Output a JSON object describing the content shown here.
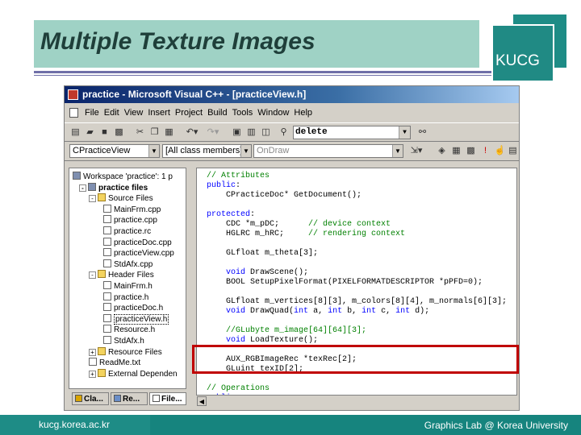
{
  "slide": {
    "title": "Multiple Texture Images",
    "logo": "KUCG",
    "footer_left": "kucg.korea.ac.kr",
    "footer_right": "Graphics Lab @ Korea University"
  },
  "window": {
    "title": "practice - Microsoft Visual C++ - [practiceView.h]",
    "menu": [
      "File",
      "Edit",
      "View",
      "Insert",
      "Project",
      "Build",
      "Tools",
      "Window",
      "Help"
    ],
    "find_value": "delete",
    "class_combo": "CPracticeView",
    "members_combo": "[All class members]",
    "function_combo": "OnDraw"
  },
  "workspace": {
    "rows": [
      {
        "label": "Workspace 'practice': 1 p",
        "depth": 0,
        "icon": "workspace-icon",
        "exp": ""
      },
      {
        "label": "practice files",
        "depth": 1,
        "icon": "project-icon",
        "exp": "-",
        "bold": true
      },
      {
        "label": "Source Files",
        "depth": 2,
        "icon": "folder-icon",
        "exp": "-"
      },
      {
        "label": "MainFrm.cpp",
        "depth": 3,
        "icon": "file-icon",
        "exp": ""
      },
      {
        "label": "practice.cpp",
        "depth": 3,
        "icon": "file-icon",
        "exp": ""
      },
      {
        "label": "practice.rc",
        "depth": 3,
        "icon": "file-icon",
        "exp": ""
      },
      {
        "label": "practiceDoc.cpp",
        "depth": 3,
        "icon": "file-icon",
        "exp": ""
      },
      {
        "label": "practiceView.cpp",
        "depth": 3,
        "icon": "file-icon",
        "exp": ""
      },
      {
        "label": "StdAfx.cpp",
        "depth": 3,
        "icon": "file-icon",
        "exp": ""
      },
      {
        "label": "Header Files",
        "depth": 2,
        "icon": "folder-icon",
        "exp": "-"
      },
      {
        "label": "MainFrm.h",
        "depth": 3,
        "icon": "file-icon",
        "exp": ""
      },
      {
        "label": "practice.h",
        "depth": 3,
        "icon": "file-icon",
        "exp": ""
      },
      {
        "label": "practiceDoc.h",
        "depth": 3,
        "icon": "file-icon",
        "exp": ""
      },
      {
        "label": "practiceView.h",
        "depth": 3,
        "icon": "file-icon",
        "exp": "",
        "selected": true
      },
      {
        "label": "Resource.h",
        "depth": 3,
        "icon": "file-icon",
        "exp": ""
      },
      {
        "label": "StdAfx.h",
        "depth": 3,
        "icon": "file-icon",
        "exp": ""
      },
      {
        "label": "Resource Files",
        "depth": 2,
        "icon": "folder-icon",
        "exp": "+"
      },
      {
        "label": "ReadMe.txt",
        "depth": 2,
        "icon": "file-icon",
        "exp": ""
      },
      {
        "label": "External Dependen",
        "depth": 2,
        "icon": "folder-icon",
        "exp": "+"
      }
    ],
    "tabs": [
      "Cla...",
      "Re...",
      "File..."
    ]
  },
  "code": [
    {
      "parts": [
        {
          "c": "cm",
          "t": "// Attributes"
        }
      ]
    },
    {
      "parts": [
        {
          "c": "kw",
          "t": "public"
        },
        {
          "c": "",
          "t": ":"
        }
      ]
    },
    {
      "parts": [
        {
          "c": "",
          "t": "    CPracticeDoc* GetDocument();"
        }
      ]
    },
    {
      "parts": [
        {
          "c": "",
          "t": ""
        }
      ]
    },
    {
      "parts": [
        {
          "c": "kw",
          "t": "protected"
        },
        {
          "c": "",
          "t": ":"
        }
      ]
    },
    {
      "parts": [
        {
          "c": "",
          "t": "    CDC *m_pDC;      "
        },
        {
          "c": "cm",
          "t": "// device context"
        }
      ]
    },
    {
      "parts": [
        {
          "c": "",
          "t": "    HGLRC m_hRC;     "
        },
        {
          "c": "cm",
          "t": "// rendering context"
        }
      ]
    },
    {
      "parts": [
        {
          "c": "",
          "t": ""
        }
      ]
    },
    {
      "parts": [
        {
          "c": "",
          "t": "    GLfloat m_theta[3];"
        }
      ]
    },
    {
      "parts": [
        {
          "c": "",
          "t": ""
        }
      ]
    },
    {
      "parts": [
        {
          "c": "",
          "t": "    "
        },
        {
          "c": "kw",
          "t": "void"
        },
        {
          "c": "",
          "t": " DrawScene();"
        }
      ]
    },
    {
      "parts": [
        {
          "c": "",
          "t": "    BOOL SetupPixelFormat(PIXELFORMATDESCRIPTOR *pPFD=0);"
        }
      ]
    },
    {
      "parts": [
        {
          "c": "",
          "t": ""
        }
      ]
    },
    {
      "parts": [
        {
          "c": "",
          "t": "    GLfloat m_vertices[8][3], m_colors[8][4], m_normals[6][3];"
        }
      ]
    },
    {
      "parts": [
        {
          "c": "",
          "t": "    "
        },
        {
          "c": "kw",
          "t": "void"
        },
        {
          "c": "",
          "t": " DrawQuad("
        },
        {
          "c": "kw",
          "t": "int"
        },
        {
          "c": "",
          "t": " a, "
        },
        {
          "c": "kw",
          "t": "int"
        },
        {
          "c": "",
          "t": " b, "
        },
        {
          "c": "kw",
          "t": "int"
        },
        {
          "c": "",
          "t": " c, "
        },
        {
          "c": "kw",
          "t": "int"
        },
        {
          "c": "",
          "t": " d);"
        }
      ]
    },
    {
      "parts": [
        {
          "c": "",
          "t": ""
        }
      ]
    },
    {
      "parts": [
        {
          "c": "",
          "t": "    "
        },
        {
          "c": "cm",
          "t": "//GLubyte m_image[64][64][3];"
        }
      ]
    },
    {
      "parts": [
        {
          "c": "",
          "t": "    "
        },
        {
          "c": "kw",
          "t": "void"
        },
        {
          "c": "",
          "t": " LoadTexture();"
        }
      ]
    },
    {
      "parts": [
        {
          "c": "",
          "t": ""
        }
      ]
    },
    {
      "parts": [
        {
          "c": "",
          "t": "    AUX_RGBImageRec *texRec[2];"
        }
      ]
    },
    {
      "parts": [
        {
          "c": "",
          "t": "    GLuint texID[2];"
        }
      ]
    },
    {
      "parts": [
        {
          "c": "",
          "t": ""
        }
      ]
    },
    {
      "parts": [
        {
          "c": "cm",
          "t": "// Operations"
        }
      ]
    },
    {
      "parts": [
        {
          "c": "kw",
          "t": "public"
        },
        {
          "c": "",
          "t": ":"
        }
      ]
    }
  ],
  "colors": {
    "title_bg": "#9fd2c5",
    "accent_teal": "#1e8c86",
    "highlight": "#c00000",
    "keyword": "#0000ff",
    "comment": "#008000"
  }
}
